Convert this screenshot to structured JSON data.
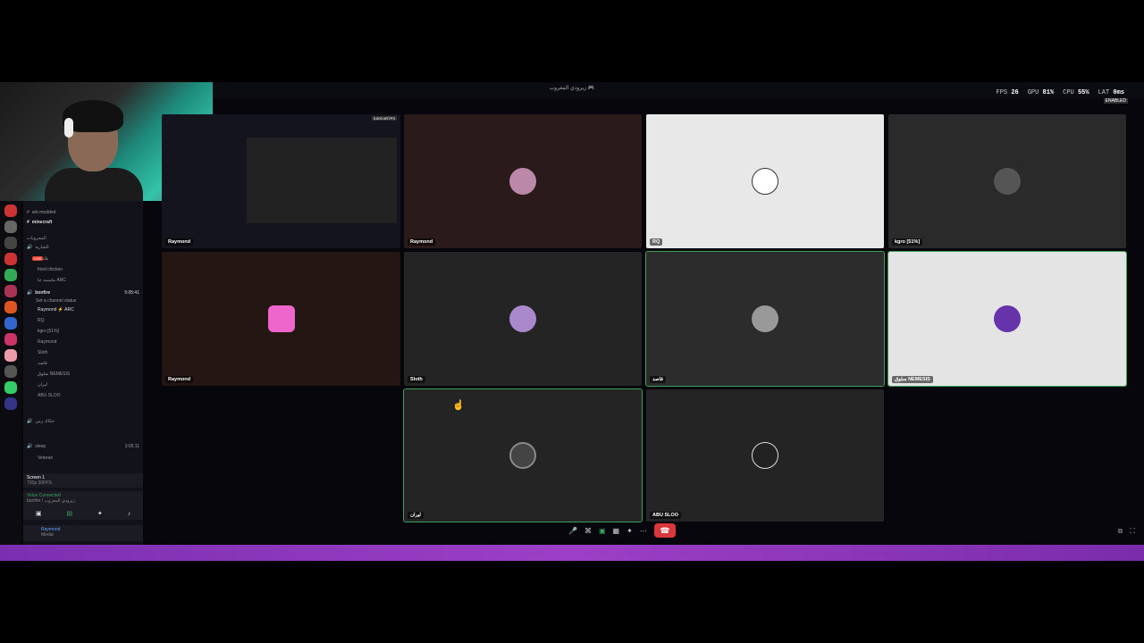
{
  "window": {
    "title": "زيرودي المغروب 🎮"
  },
  "stats": {
    "fps_label": "FPS",
    "fps": "26",
    "gpu_label": "GPU",
    "gpu": "81%",
    "cpu_label": "CPU",
    "cpu": "55%",
    "lat_label": "LAT",
    "lat": "0ms",
    "enabled": "ENABLED"
  },
  "channels": {
    "rows": [
      {
        "label": "ark-modded"
      },
      {
        "label": "minecraft",
        "bold": true
      },
      {
        "label": "المجروبات"
      },
      {
        "label": "الشارية"
      },
      {
        "label": "بلامان"
      },
      {
        "label": "fried chicken"
      },
      {
        "label": "ماسمه جا ARC"
      },
      {
        "label": "bonfire",
        "bold": true
      },
      {
        "label": "Set a channel status"
      },
      {
        "label": "Raymond ⚡ ARC"
      },
      {
        "label": "RQ"
      },
      {
        "label": "kgro [51%]"
      },
      {
        "label": "Raymond"
      },
      {
        "label": "Sloth"
      },
      {
        "label": "قاصد"
      },
      {
        "label": "سلوق NEMESIS"
      },
      {
        "label": "ليران"
      },
      {
        "label": "ABU SLOO"
      },
      {
        "label": "حكاك زمن"
      },
      {
        "label": "sleep"
      },
      {
        "label": "Veteran"
      }
    ],
    "bonfire_time": "5:05:41",
    "sleep_time": "3:05:11",
    "live": "LIVE"
  },
  "screen": {
    "title": "Screen 1",
    "sub": "720p 30FPS"
  },
  "voice": {
    "status": "Voice Connected",
    "sub": "bonfire / زيرودي المغروب"
  },
  "user": {
    "name": "Raymond",
    "status": "Medal"
  },
  "preview": {
    "viewers": "5,800 ARTPS",
    "live": "LIVE"
  },
  "tiles": [
    {
      "label": "Raymond",
      "bg": "#14141e",
      "av": "#333"
    },
    {
      "label": "Raymond",
      "bg": "#2b1a1a",
      "av": "#b8a"
    },
    {
      "label": "RQ",
      "bg": "#e8e8e8",
      "av": "#fff"
    },
    {
      "label": "kgro [51%]",
      "bg": "#2a2a2a",
      "av": "#555"
    },
    {
      "label": "Raymond",
      "bg": "#241612",
      "av": "#e6c"
    },
    {
      "label": "Sloth",
      "bg": "#242424",
      "av": "#a8c"
    },
    {
      "label": "قاصد",
      "bg": "#2c2c2c",
      "av": "#999"
    },
    {
      "label": "سلوق NEMESIS",
      "bg": "#e4e4e4",
      "av": "#63a"
    },
    {
      "label": "ليران",
      "bg": "#242424",
      "av": "#444"
    },
    {
      "label": "ABU SLOO",
      "bg": "#242424",
      "av": "#222"
    }
  ]
}
